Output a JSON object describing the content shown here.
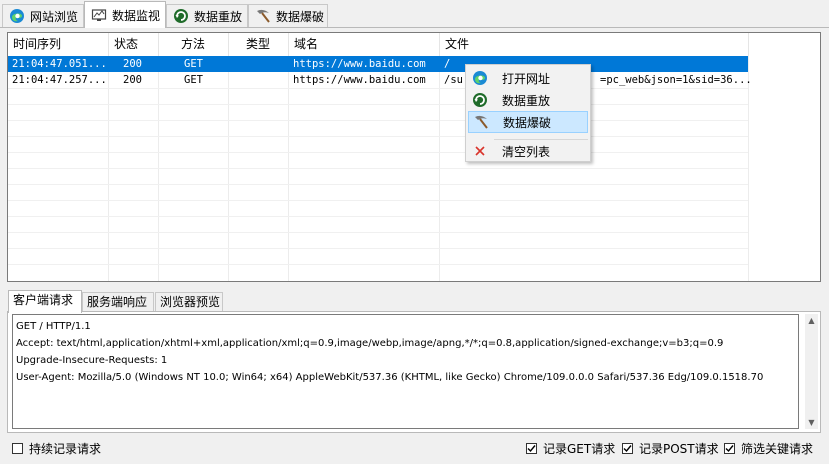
{
  "top_tabs": [
    {
      "label": "网站浏览",
      "icon": "edge-icon"
    },
    {
      "label": "数据监视",
      "icon": "monitor-icon"
    },
    {
      "label": "数据重放",
      "icon": "replay-icon"
    },
    {
      "label": "数据爆破",
      "icon": "pickaxe-icon"
    }
  ],
  "active_top_tab": "数据监视",
  "list": {
    "columns": [
      "时间序列",
      "状态",
      "方法",
      "类型",
      "域名",
      "文件"
    ],
    "rows": [
      {
        "time": "21:04:47.051...",
        "status": "200",
        "method": "GET",
        "type": "",
        "domain": "https://www.baidu.com",
        "file": "/",
        "selected": true
      },
      {
        "time": "21:04:47.257...",
        "status": "200",
        "method": "GET",
        "type": "",
        "domain": "https://www.baidu.com",
        "file_prefix": "/su",
        "file_suffix": "=pc_web&json=1&sid=36...",
        "selected": false
      }
    ]
  },
  "context_menu": {
    "items": [
      {
        "label": "打开网址",
        "icon": "edge-icon"
      },
      {
        "label": "数据重放",
        "icon": "replay-icon"
      },
      {
        "label": "数据爆破",
        "icon": "pickaxe-icon"
      },
      {
        "label": "清空列表",
        "icon": "clear-icon"
      }
    ],
    "highlighted": "数据爆破"
  },
  "bottom_tabs": [
    "客户端请求",
    "服务端响应",
    "浏览器预览"
  ],
  "active_bottom_tab": "客户端请求",
  "request_text": [
    "GET / HTTP/1.1",
    "Accept: text/html,application/xhtml+xml,application/xml;q=0.9,image/webp,image/apng,*/*;q=0.8,application/signed-exchange;v=b3;q=0.9",
    "Upgrade-Insecure-Requests: 1",
    "User-Agent: Mozilla/5.0 (Windows NT 10.0; Win64; x64) AppleWebKit/537.36 (KHTML, like Gecko) Chrome/109.0.0.0 Safari/537.36 Edg/109.0.1518.70"
  ],
  "footer": {
    "continuous_record": {
      "label": "持续记录请求",
      "checked": false
    },
    "record_get": {
      "label": "记录GET请求",
      "checked": true
    },
    "record_post": {
      "label": "记录POST请求",
      "checked": true
    },
    "filter_keywords": {
      "label": "筛选关键请求",
      "checked": true
    }
  },
  "colors": {
    "selection": "#0078d7",
    "menu_hover": "#cce8ff",
    "window_bg": "#f0f0f0"
  }
}
